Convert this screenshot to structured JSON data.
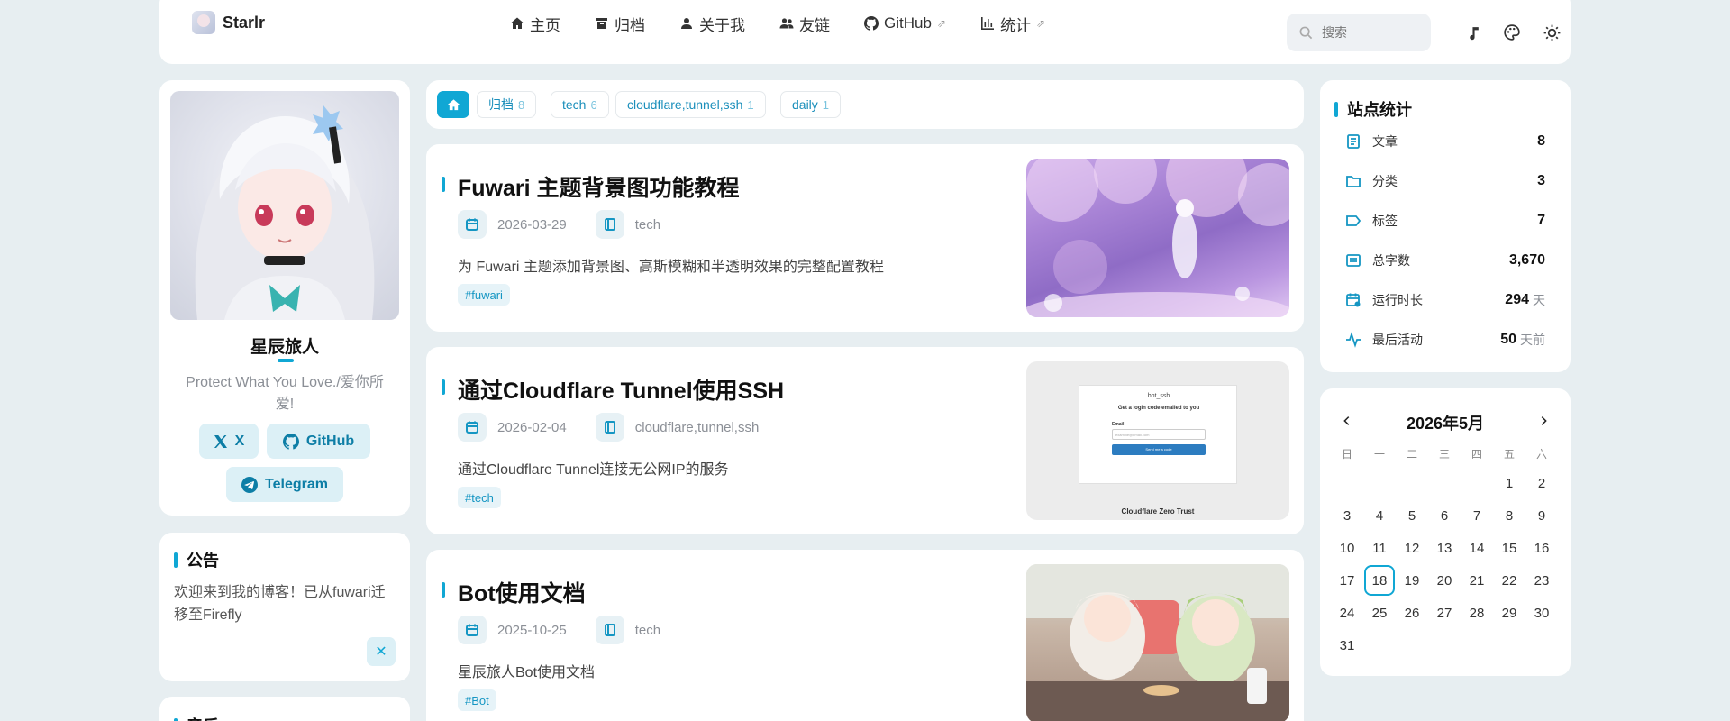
{
  "brand": {
    "name": "Starlr"
  },
  "nav": {
    "links": [
      {
        "label": "主页",
        "icon": "home-icon",
        "external": false
      },
      {
        "label": "归档",
        "icon": "archive-icon",
        "external": false
      },
      {
        "label": "关于我",
        "icon": "user-icon",
        "external": false
      },
      {
        "label": "友链",
        "icon": "friends-icon",
        "external": false
      },
      {
        "label": "GitHub",
        "icon": "github-icon",
        "external": true
      },
      {
        "label": "统计",
        "icon": "chart-icon",
        "external": true
      }
    ],
    "search_placeholder": "搜索"
  },
  "profile": {
    "name": "星辰旅人",
    "bio": "Protect What You Love./爱你所爱!",
    "socials": [
      {
        "label": "X",
        "icon": "x-icon"
      },
      {
        "label": "GitHub",
        "icon": "github-icon"
      },
      {
        "label": "Telegram",
        "icon": "telegram-icon"
      }
    ]
  },
  "notice": {
    "title": "公告",
    "text": "欢迎来到我的博客！已从fuwari迁移至Firefly",
    "close_label": "✕"
  },
  "music": {
    "title": "音乐"
  },
  "filters": [
    {
      "label": "归档",
      "count": "8"
    },
    {
      "label": "tech",
      "count": "6"
    },
    {
      "label": "cloudflare,tunnel,ssh",
      "count": "1"
    },
    {
      "label": "daily",
      "count": "1"
    }
  ],
  "posts": [
    {
      "title": "Fuwari 主题背景图功能教程",
      "date": "2026-03-29",
      "category": "tech",
      "description": "为 Fuwari 主题添加背景图、高斯模糊和半透明效果的完整配置教程",
      "tag": "#fuwari"
    },
    {
      "title": "通过Cloudflare Tunnel使用SSH",
      "date": "2026-02-04",
      "category": "cloudflare,tunnel,ssh",
      "description": "通过Cloudflare Tunnel连接无公网IP的服务",
      "tag": "#tech",
      "thumb": {
        "heading": "bot_ssh",
        "sub": "Get a login code emailed to you",
        "email_label": "Email",
        "email_placeholder": "example@email.com",
        "button": "Send me a code",
        "footer": "Cloudflare Zero Trust"
      }
    },
    {
      "title": "Bot使用文档",
      "date": "2025-10-25",
      "category": "tech",
      "description": "星辰旅人Bot使用文档",
      "tag": "#Bot"
    }
  ],
  "stats": {
    "title": "站点统计",
    "rows": [
      {
        "label": "文章",
        "value": "8",
        "unit": "",
        "icon": "document-icon"
      },
      {
        "label": "分类",
        "value": "3",
        "unit": "",
        "icon": "folder-icon"
      },
      {
        "label": "标签",
        "value": "7",
        "unit": "",
        "icon": "tag-icon"
      },
      {
        "label": "总字数",
        "value": "3,670",
        "unit": "",
        "icon": "text-icon"
      },
      {
        "label": "运行时长",
        "value": "294",
        "unit": "天",
        "icon": "calendar-clock-icon"
      },
      {
        "label": "最后活动",
        "value": "50",
        "unit": "天前",
        "icon": "activity-icon"
      }
    ]
  },
  "calendar": {
    "title": "2026年5月",
    "weekdays": [
      "日",
      "一",
      "二",
      "三",
      "四",
      "五",
      "六"
    ],
    "lead_blanks": 5,
    "days": 31,
    "today": 18
  },
  "colors": {
    "accent": "#10a7d4",
    "background": "#e7eef1"
  }
}
